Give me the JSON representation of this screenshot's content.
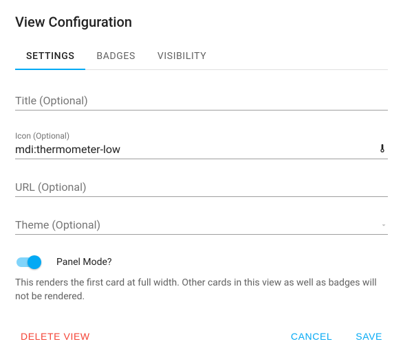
{
  "dialog": {
    "title": "View Configuration"
  },
  "tabs": [
    {
      "label": "Settings",
      "active": true
    },
    {
      "label": "Badges",
      "active": false
    },
    {
      "label": "Visibility",
      "active": false
    }
  ],
  "fields": {
    "title": {
      "label": "Title (Optional)",
      "value": ""
    },
    "icon": {
      "label": "Icon (Optional)",
      "value": "mdi:thermometer-low",
      "icon": "thermometer-low"
    },
    "url": {
      "label": "URL (Optional)",
      "value": ""
    },
    "theme": {
      "label": "Theme (Optional)",
      "value": ""
    }
  },
  "panel_mode": {
    "label": "Panel Mode?",
    "enabled": true,
    "description": "This renders the first card at full width. Other cards in this view as well as badges will not be rendered."
  },
  "actions": {
    "delete": "Delete View",
    "cancel": "Cancel",
    "save": "Save"
  }
}
